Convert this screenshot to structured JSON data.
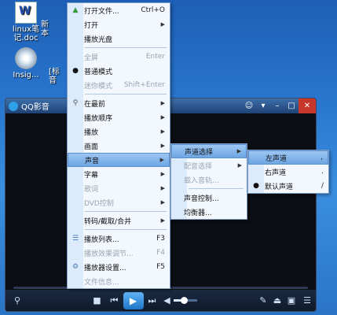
{
  "desktop": {
    "icons": [
      {
        "label_line1": "linux笔",
        "label_line2": "记.doc"
      },
      {
        "label_line1": "Insig...",
        "label_line2": ""
      },
      {
        "label_line1": "新",
        "label_line2": "本"
      },
      {
        "label_line1": "[标",
        "label_line2": "音"
      }
    ]
  },
  "player": {
    "title": "QQ影音",
    "volume_fraction": 0.45
  },
  "main_menu": {
    "items": [
      {
        "label": "打开文件...",
        "shortcut": "Ctrl+O"
      },
      {
        "label": "打开",
        "arrow": "▶"
      },
      {
        "label": "播放光盘"
      },
      {
        "label": "全屏",
        "shortcut": "Enter"
      },
      {
        "label": "普通模式"
      },
      {
        "label": "迷你模式",
        "shortcut": "Shift+Enter"
      },
      {
        "label": "在最前",
        "arrow": "▶"
      },
      {
        "label": "播放顺序",
        "arrow": "▶"
      },
      {
        "label": "播放",
        "arrow": "▶"
      },
      {
        "label": "画面",
        "arrow": "▶"
      },
      {
        "label": "声音",
        "arrow": "▶"
      },
      {
        "label": "字幕",
        "arrow": "▶"
      },
      {
        "label": "歌词",
        "arrow": "▶"
      },
      {
        "label": "DVD控制",
        "arrow": "▶"
      },
      {
        "label": "转码/截取/合并",
        "arrow": "▶"
      },
      {
        "label": "播放列表...",
        "shortcut": "F3"
      },
      {
        "label": "播放效果调节...",
        "shortcut": "F4"
      },
      {
        "label": "播放器设置...",
        "shortcut": "F5"
      },
      {
        "label": "文件信息..."
      }
    ]
  },
  "sound_menu": {
    "items": [
      {
        "label": "声道选择",
        "arrow": "▶"
      },
      {
        "label": "配音选择",
        "arrow": "▶"
      },
      {
        "label": "载入音轨..."
      },
      {
        "label": "声音控制..."
      },
      {
        "label": "均衡器..."
      }
    ]
  },
  "channel_menu": {
    "items": [
      {
        "label": "左声道",
        "shortcut": ","
      },
      {
        "label": "右声道",
        "shortcut": "."
      },
      {
        "label": "默认声道",
        "shortcut": "/"
      }
    ]
  }
}
